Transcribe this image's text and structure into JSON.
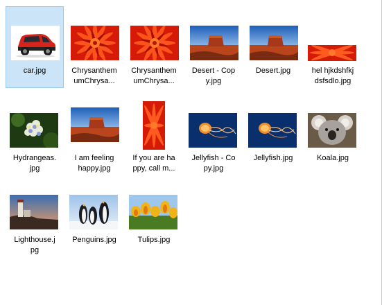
{
  "files": [
    {
      "name": "car.jpg",
      "line1": "car.jpg",
      "line2": "",
      "selected": true,
      "thumb": "car"
    },
    {
      "name": "Chrysanthemum Chrysanthemum.jpg",
      "line1": "Chrysanthem",
      "line2": "umChrysa...",
      "selected": false,
      "thumb": "flower"
    },
    {
      "name": "Chrysanthemum Chrysanthemum copy.jpg",
      "line1": "Chrysanthem",
      "line2": "umChrysa...",
      "selected": false,
      "thumb": "flower"
    },
    {
      "name": "Desert - Copy.jpg",
      "line1": "Desert - Cop",
      "line2": "y.jpg",
      "selected": false,
      "thumb": "desert"
    },
    {
      "name": "Desert.jpg",
      "line1": "Desert.jpg",
      "line2": "",
      "selected": false,
      "thumb": "desert"
    },
    {
      "name": "hel hjkdshfkj dsfsdlo.jpg",
      "line1": "hel hjkdshfkj",
      "line2": "dsfsdlo.jpg",
      "selected": false,
      "thumb": "flower-strip"
    },
    {
      "name": "Hydrangeas.jpg",
      "line1": "Hydrangeas.",
      "line2": "jpg",
      "selected": false,
      "thumb": "hydrangea"
    },
    {
      "name": "I am feeling happy.jpg",
      "line1": "I am feeling",
      "line2": "happy.jpg",
      "selected": false,
      "thumb": "desert"
    },
    {
      "name": "If you are happy, call me.jpg",
      "line1": "If you are ha",
      "line2": "ppy, call m...",
      "selected": false,
      "thumb": "flower-tall"
    },
    {
      "name": "Jellyfish - Copy.jpg",
      "line1": "Jellyfish - Co",
      "line2": "py.jpg",
      "selected": false,
      "thumb": "jellyfish"
    },
    {
      "name": "Jellyfish.jpg",
      "line1": "Jellyfish.jpg",
      "line2": "",
      "selected": false,
      "thumb": "jellyfish"
    },
    {
      "name": "Koala.jpg",
      "line1": "Koala.jpg",
      "line2": "",
      "selected": false,
      "thumb": "koala"
    },
    {
      "name": "Lighthouse.jpg",
      "line1": "Lighthouse.j",
      "line2": "pg",
      "selected": false,
      "thumb": "lighthouse"
    },
    {
      "name": "Penguins.jpg",
      "line1": "Penguins.jpg",
      "line2": "",
      "selected": false,
      "thumb": "penguins"
    },
    {
      "name": "Tulips.jpg",
      "line1": "Tulips.jpg",
      "line2": "",
      "selected": false,
      "thumb": "tulips"
    }
  ],
  "colors": {
    "selection_bg": "#cce4f7",
    "selection_border": "#99c9ef"
  }
}
